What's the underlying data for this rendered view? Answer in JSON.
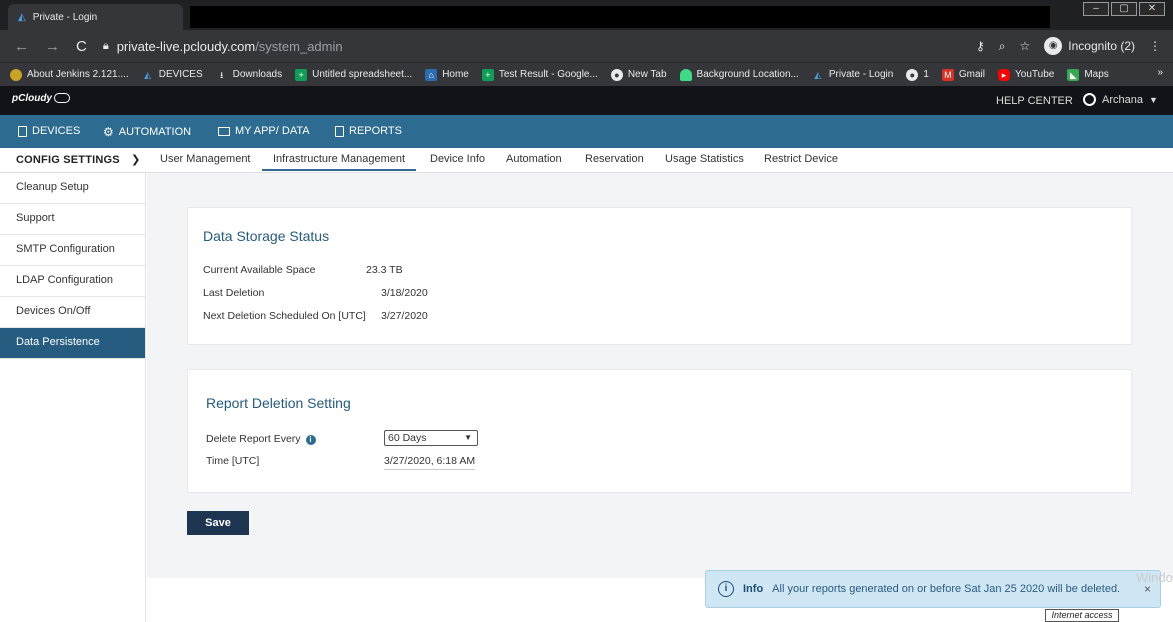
{
  "browser": {
    "tab_title": "Private - Login",
    "url_host": "private-live.pcloudy.com",
    "url_path": "/system_admin",
    "incognito_label": "Incognito (2)",
    "window_controls": [
      "–",
      "▢",
      "✕"
    ],
    "bookmarks": [
      {
        "label": "About Jenkins 2.121....",
        "color": "#c9a227",
        "icon": "jenkins-icon"
      },
      {
        "label": "DEVICES",
        "color": "#2d6b91",
        "icon": "pcloudy-icon"
      },
      {
        "label": "Downloads",
        "color": "#35363a",
        "icon": "download-icon"
      },
      {
        "label": "Untitled spreadsheet...",
        "color": "#0f9d58",
        "icon": "sheets-icon"
      },
      {
        "label": "Home",
        "color": "#2b6cb0",
        "icon": "home-icon"
      },
      {
        "label": "Test Result - Google...",
        "color": "#0f9d58",
        "icon": "sheets-icon"
      },
      {
        "label": "New Tab",
        "color": "#5f6368",
        "icon": "globe-icon"
      },
      {
        "label": "Background Location...",
        "color": "#3ddc84",
        "icon": "android-icon"
      },
      {
        "label": "Private - Login",
        "color": "#2d6b91",
        "icon": "pcloudy-icon"
      },
      {
        "label": "1",
        "color": "#5f6368",
        "icon": "globe-icon"
      },
      {
        "label": "Gmail",
        "color": "#d93025",
        "icon": "gmail-icon"
      },
      {
        "label": "YouTube",
        "color": "#ff0000",
        "icon": "youtube-icon"
      },
      {
        "label": "Maps",
        "color": "#34a853",
        "icon": "maps-icon"
      }
    ],
    "more": "»"
  },
  "header": {
    "logo": "pCloudy",
    "help": "HELP CENTER",
    "user": "Archana"
  },
  "mainnav": [
    "DEVICES",
    "AUTOMATION",
    "MY APP/ DATA",
    "REPORTS"
  ],
  "subnav": {
    "config": "CONFIG SETTINGS",
    "tabs": [
      "User Management",
      "Infrastructure Management",
      "Device Info",
      "Automation",
      "Reservation",
      "Usage Statistics",
      "Restrict Device"
    ]
  },
  "sidebar": [
    "Cleanup Setup",
    "Support",
    "SMTP Configuration",
    "LDAP Configuration",
    "Devices On/Off",
    "Data Persistence"
  ],
  "storage": {
    "title": "Data Storage Status",
    "rows": [
      {
        "label": "Current Available Space",
        "value": "23.3 TB"
      },
      {
        "label": "Last Deletion",
        "value": "3/18/2020"
      },
      {
        "label": "Next Deletion Scheduled On [UTC]",
        "value": "3/27/2020"
      }
    ]
  },
  "report": {
    "title": "Report Deletion Setting",
    "delete_label": "Delete Report Every",
    "delete_value": "60 Days",
    "time_label": "Time [UTC]",
    "time_value": "3/27/2020, 6:18 AM"
  },
  "save_label": "Save",
  "toast": {
    "label": "Info",
    "message": "All your reports generated on or before Sat Jan 25 2020 will be deleted.",
    "close": "×"
  },
  "watermark": "Windo",
  "tooltip": "Internet access"
}
